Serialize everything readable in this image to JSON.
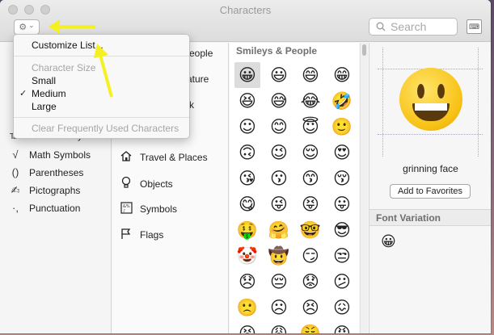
{
  "window": {
    "title": "Characters"
  },
  "toolbar": {
    "gear_icon": "⚙",
    "chevron_icon": "⌄",
    "search_placeholder": "Search",
    "keyboard_icon": "⌨"
  },
  "menu": {
    "customize": "Customize List...",
    "size_header": "Character Size",
    "sizes": [
      "Small",
      "Medium",
      "Large"
    ],
    "selected_size": "Medium",
    "clear": "Clear Frequently Used Characters"
  },
  "categories_left": [
    {
      "label": "Letterlike Symbols",
      "icon": "℡"
    },
    {
      "label": "Math Symbols",
      "icon": "√"
    },
    {
      "label": "Parentheses",
      "icon": "()"
    },
    {
      "label": "Pictographs",
      "icon": "✍"
    },
    {
      "label": "Punctuation",
      "icon": "·,"
    }
  ],
  "categories_right": [
    {
      "label": "Smileys & People",
      "icon": "☺",
      "visible": "eople"
    },
    {
      "label": "Animals & Nature",
      "icon": "🐻",
      "visible": "ature"
    },
    {
      "label": "Food & Drink",
      "icon": "☕",
      "visible": "k"
    },
    {
      "label": "Travel & Places",
      "icon": "🏠"
    },
    {
      "label": "Objects",
      "icon": "💡"
    },
    {
      "label": "Symbols",
      "icon": "⁂"
    },
    {
      "label": "Flags",
      "icon": "⚑"
    }
  ],
  "grid": {
    "section": "Smileys & People",
    "emojis": [
      "😀",
      "😃",
      "😄",
      "😁",
      "😆",
      "😅",
      "😂",
      "🤣",
      "☺",
      "😊",
      "😇",
      "🙂",
      "🙃",
      "😉",
      "😌",
      "😍",
      "😘",
      "😗",
      "😙",
      "😚",
      "😋",
      "😜",
      "😝",
      "😛",
      "🤑",
      "🤗",
      "🤓",
      "😎",
      "🤡",
      "🤠",
      "😏",
      "😒",
      "😞",
      "😔",
      "😟",
      "😕",
      "🙁",
      "☹",
      "😣",
      "😖",
      "😫",
      "😩",
      "😤",
      "😠"
    ]
  },
  "detail": {
    "name": "grinning face",
    "favorites_button": "Add to Favorites",
    "font_variation_header": "Font Variation",
    "variation_emoji": "😀"
  },
  "colors": {
    "highlight_arrow": "#f5f021"
  }
}
